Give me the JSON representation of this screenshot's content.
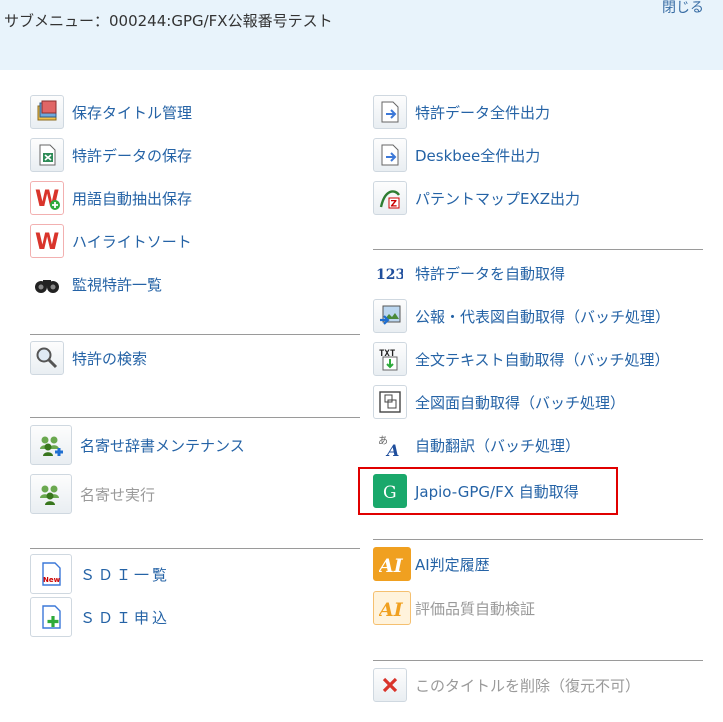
{
  "header": {
    "title": "サブメニュー：000244:GPG/FX公報番号テスト",
    "close_label": "閉じる"
  },
  "left_menu": [
    {
      "label": "保存タイトル管理",
      "icon": "title-management-icon",
      "enabled": true
    },
    {
      "label": "特許データの保存",
      "icon": "excel-save-icon",
      "enabled": true
    },
    {
      "label": "用語自動抽出保存",
      "icon": "word-extract-icon",
      "enabled": true
    },
    {
      "label": "ハイライトソート",
      "icon": "highlight-sort-icon",
      "enabled": true
    },
    {
      "label": "監視特許一覧",
      "icon": "binoculars-icon",
      "enabled": true
    },
    {
      "label": "特許の検索",
      "icon": "search-icon",
      "enabled": true
    },
    {
      "label": "名寄せ辞書メンテナンス",
      "icon": "users-dictionary-icon",
      "enabled": true
    },
    {
      "label": "名寄せ実行",
      "icon": "users-merge-icon",
      "enabled": false
    },
    {
      "label": "ＳＤＩ一覧",
      "icon": "sdi-new-icon",
      "enabled": true
    },
    {
      "label": "ＳＤＩ申込",
      "icon": "sdi-add-icon",
      "enabled": true
    }
  ],
  "right_menu": [
    {
      "label": "特許データ全件出力",
      "icon": "export-icon",
      "enabled": true
    },
    {
      "label": "Deskbee全件出力",
      "icon": "export-icon",
      "enabled": true
    },
    {
      "label": "パテントマップEXZ出力",
      "icon": "patent-map-icon",
      "enabled": true
    },
    {
      "label": "特許データを自動取得",
      "icon": "auto-fetch-123-icon",
      "enabled": true
    },
    {
      "label": "公報・代表図自動取得（バッチ処理）",
      "icon": "image-fetch-icon",
      "enabled": true
    },
    {
      "label": "全文テキスト自動取得（バッチ処理）",
      "icon": "txt-fetch-icon",
      "enabled": true
    },
    {
      "label": "全図面自動取得（バッチ処理）",
      "icon": "drawing-fetch-icon",
      "enabled": true
    },
    {
      "label": "自動翻訳（バッチ処理）",
      "icon": "translate-icon",
      "enabled": true
    },
    {
      "label": "Japio-GPG/FX 自動取得",
      "icon": "japio-g-icon",
      "enabled": true
    },
    {
      "label": "AI判定履歴",
      "icon": "ai-history-icon",
      "enabled": true
    },
    {
      "label": "評価品質自動検証",
      "icon": "ai-verify-icon",
      "enabled": false
    },
    {
      "label": "このタイトルを削除（復元不可）",
      "icon": "delete-x-icon",
      "enabled": false
    }
  ],
  "colors": {
    "header_bg": "#e8f3fb",
    "link": "#2563a6",
    "disabled": "#9a9a9a",
    "highlight": "#e00000",
    "japio_green": "#1aa86b",
    "ai_orange": "#f0a020"
  }
}
